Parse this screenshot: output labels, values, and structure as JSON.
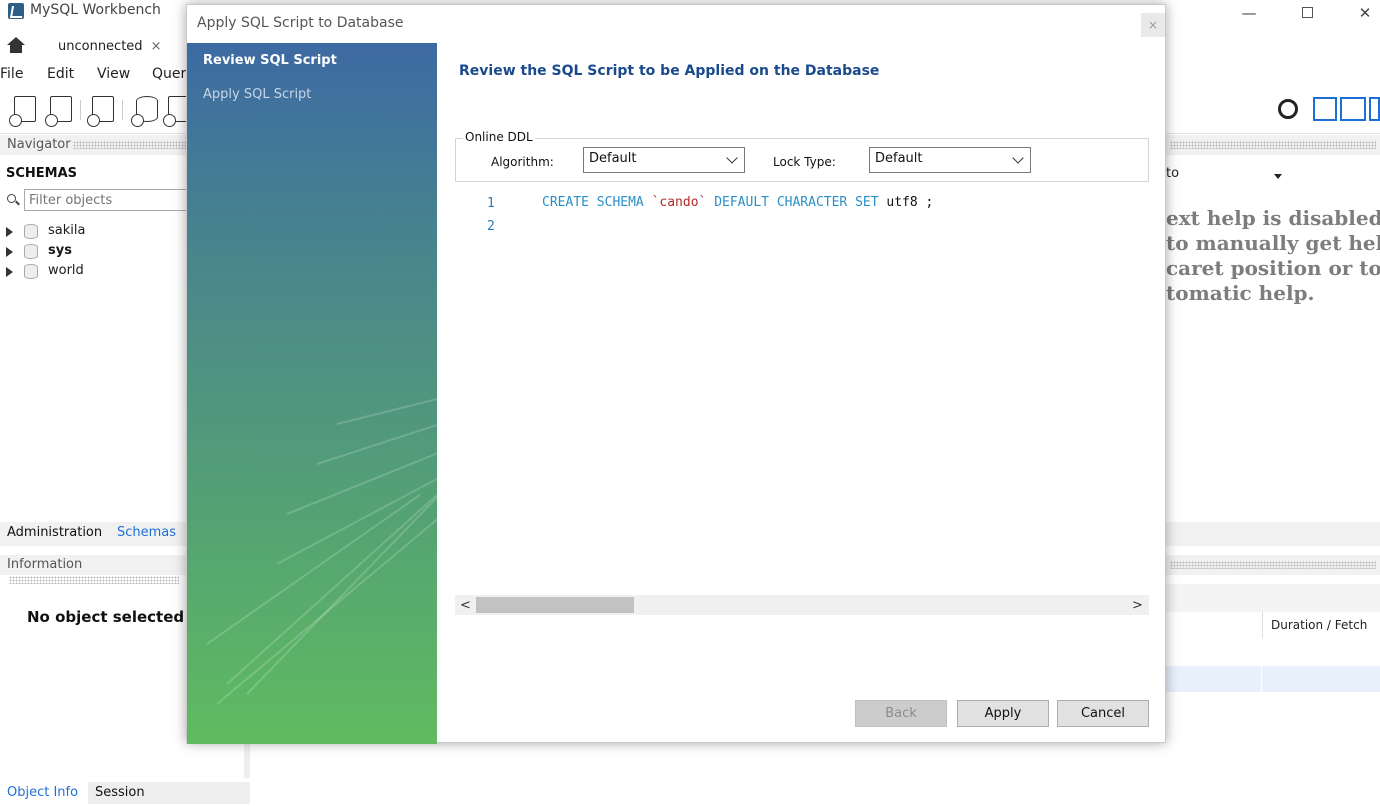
{
  "app": {
    "title": "MySQL Workbench",
    "connection_tab": "unconnected",
    "tab_close": "×"
  },
  "menu": [
    "File",
    "Edit",
    "View",
    "Quer"
  ],
  "navigator": {
    "header": "Navigator",
    "schemas_title": "SCHEMAS",
    "filter_placeholder": "Filter objects",
    "schemas": [
      {
        "name": "sakila",
        "bold": false
      },
      {
        "name": "sys",
        "bold": true
      },
      {
        "name": "world",
        "bold": false
      }
    ],
    "tabs": [
      "Administration",
      "Schemas"
    ],
    "info_header": "Information",
    "no_object": "No object selected",
    "bottom_tabs": [
      "Object Info",
      "Session"
    ]
  },
  "right_panel": {
    "jump_label": "to",
    "help_lines": [
      "ext help is disabled.",
      "to manually get help",
      "caret position or to",
      "tomatic help."
    ],
    "output_column": "Duration / Fetch"
  },
  "dialog": {
    "title": "Apply SQL Script to Database",
    "close": "×",
    "steps": [
      "Review SQL Script",
      "Apply SQL Script"
    ],
    "heading": "Review the SQL Script to be Applied on the Database",
    "online_ddl": {
      "legend": "Online DDL",
      "algorithm_label": "Algorithm:",
      "algorithm_value": "Default",
      "lock_label": "Lock Type:",
      "lock_value": "Default"
    },
    "script": {
      "line_numbers": [
        "1",
        "2"
      ],
      "kw1": "CREATE SCHEMA",
      "ident": "`cando`",
      "kw2": "DEFAULT CHARACTER SET",
      "tail": "utf8 ;"
    },
    "scroll_left": "<",
    "scroll_right": ">",
    "buttons": {
      "back": "Back",
      "apply": "Apply",
      "cancel": "Cancel"
    }
  },
  "colors": {
    "heading": "#1a4a8c",
    "keyword": "#2a8fc9",
    "identifier": "#b22a2a",
    "accent": "#1d6fd8"
  }
}
